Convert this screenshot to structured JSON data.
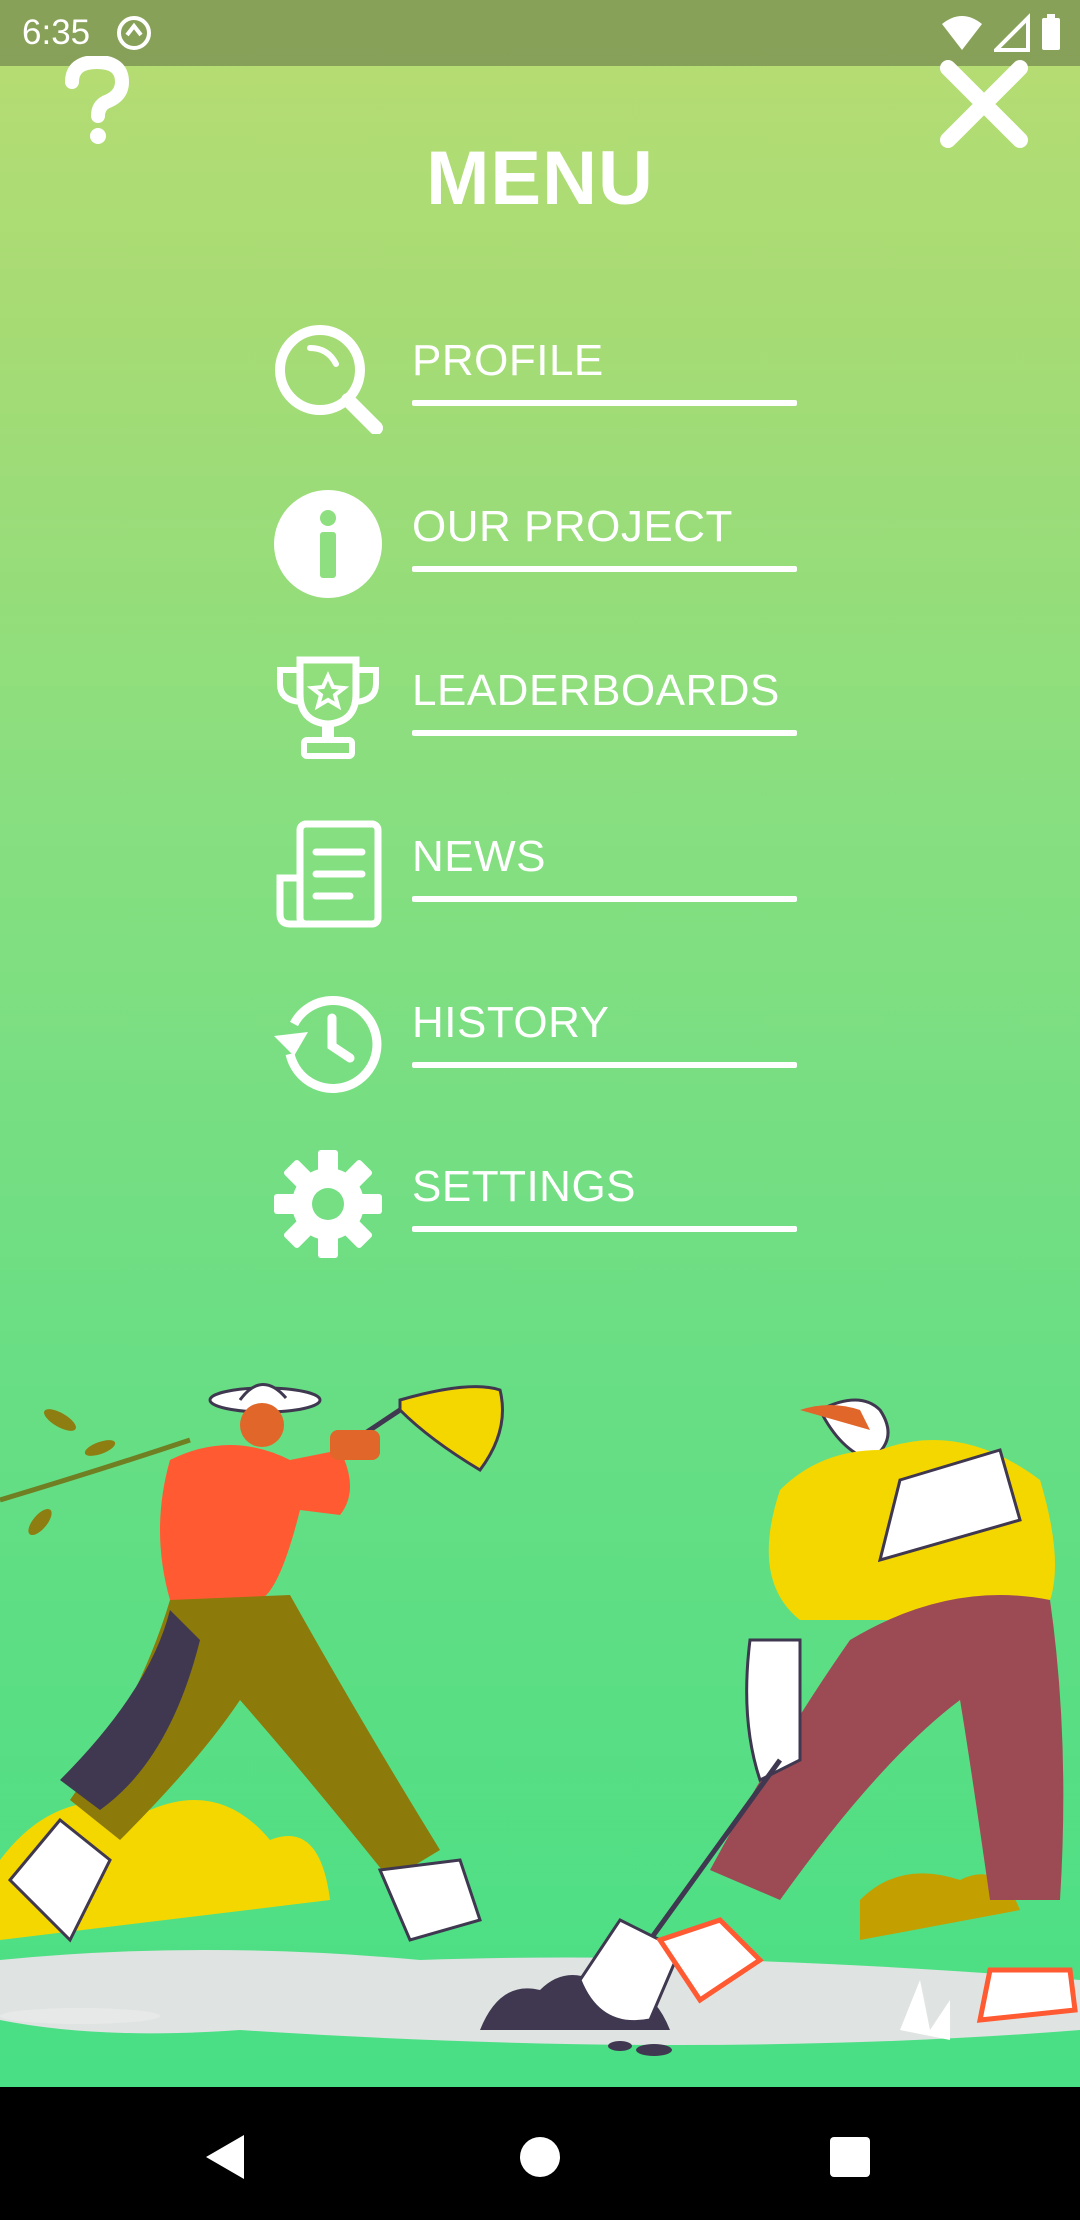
{
  "status_bar": {
    "time": "6:35"
  },
  "header": {
    "title": "MENU"
  },
  "menu": {
    "items": [
      {
        "label": "PROFILE",
        "icon": "search-icon"
      },
      {
        "label": "OUR PROJECT",
        "icon": "info-icon"
      },
      {
        "label": "LEADERBOARDS",
        "icon": "trophy-icon"
      },
      {
        "label": "NEWS",
        "icon": "newspaper-icon"
      },
      {
        "label": "HISTORY",
        "icon": "history-icon"
      },
      {
        "label": "SETTINGS",
        "icon": "gear-icon"
      }
    ]
  },
  "colors": {
    "background_top": "#b8dd73",
    "background_bottom": "#48df85",
    "text": "#ffffff"
  }
}
